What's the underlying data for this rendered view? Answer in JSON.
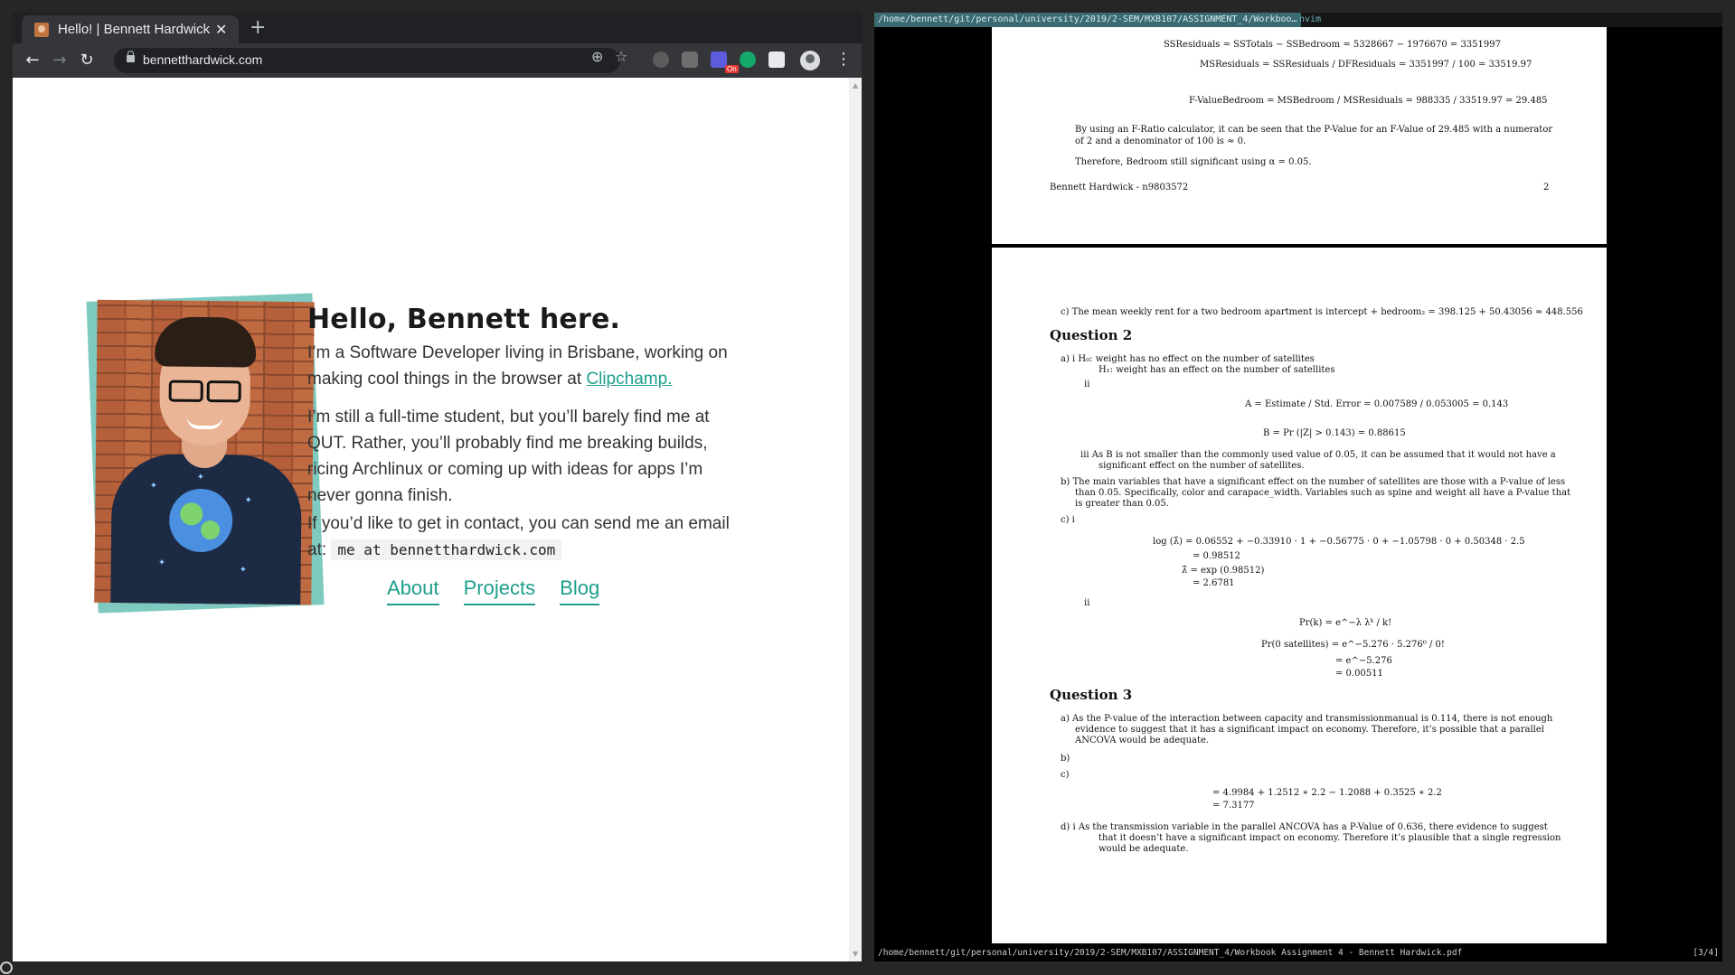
{
  "browser": {
    "tab_title": "Hello! | Bennett Hardwick",
    "tab_close": "✕",
    "new_tab": "+",
    "url": "bennetthardwick.com",
    "ext_badge": "On"
  },
  "page": {
    "heading": "Hello, Bennett here.",
    "p1_text": "I’m a Software Developer living in Brisbane, working on making cool things in the browser at ",
    "p1_link": "Clipchamp.",
    "p2_text": "I’m still a full-time student, but you’ll barely find me at QUT. Rather, you’ll probably find me breaking builds, ricing Archlinux or coming up with ideas for apps I’m never gonna finish.",
    "p3_text": "If you’d like to get in contact, you can send me an email at: ",
    "p3_email": "me at bennetthardwick.com",
    "nav": [
      "About",
      "Projects",
      "Blog"
    ],
    "accent_color": "#1e9f8c"
  },
  "viewer": {
    "title_path": "/home/bennett/git/personal/university/2019/2-SEM/MXB107/ASSIGNMENT_4/Workboo…",
    "app_name": "nvim",
    "status_path": "/home/bennett/git/personal/university/2019/2-SEM/MXB107/ASSIGNMENT_4/Workbook Assignment 4 - Bennett Hardwick.pdf",
    "page_indicator": "[3/4]",
    "page1": {
      "eq1": "SSResiduals = SSTotals − SSBedroom = 5328667 − 1976670 = 3351997",
      "eq2": "MSResiduals = SSResiduals / DFResiduals = 3351997 / 100 = 33519.97",
      "eq3": "F-ValueBedroom = MSBedroom / MSResiduals = 988335 / 33519.97 = 29.485",
      "text1": "By using an F-Ratio calculator, it can be seen that the P-Value for an F-Value of 29.485 with a numerator",
      "text1b": "of 2 and a denominator of 100 is ≈ 0.",
      "text2": "Therefore, Bedroom still significant using α = 0.05.",
      "footer_name": "Bennett Hardwick - n9803572",
      "footer_page": "2"
    },
    "page2": {
      "c_line": "c)  The mean weekly rent for a two bedroom apartment is intercept + bedroom₂ = 398.125 + 50.43056 ≈ 448.556",
      "q2": "Question 2",
      "q2a_i1": "a)      i  H₀: weight has no effect on the number of satellites",
      "q2a_i2": "H₁: weight has an effect on the number of satellites",
      "q2a_ii": "ii",
      "q2a_A": "A = Estimate / Std. Error = 0.007589 / 0.053005 = 0.143",
      "q2a_B": "B = Pr (|Z| > 0.143) = 0.88615",
      "q2a_iii1": "iii  As B is not smaller than the commonly used value of 0.05, it can be assumed that it would not have a",
      "q2a_iii2": "significant effect on the number of satellites.",
      "q2b1": "b)  The main variables that have a significant effect on the number of satellites are those with a P-value of less",
      "q2b2": "than 0.05. Specifically, color and carapace_width. Variables such as spine and weight all have a P-value that",
      "q2b3": "is greater than 0.05.",
      "q2c_i": "c)      i",
      "q2c_e1": "log (λ̂) = 0.06552 + −0.33910 · 1 + −0.56775 · 0 + −1.05798 · 0 + 0.50348 · 2.5",
      "q2c_e2": "= 0.98512",
      "q2c_e3": "λ̂ = exp (0.98512)",
      "q2c_e4": "= 2.6781",
      "q2c_ii": "ii",
      "q2c_p1": "Pr(k) = e^−λ λᵏ / k!",
      "q2c_p2": "Pr(0 satellites) = e^−5.276 · 5.276⁰ / 0!",
      "q2c_p3": "= e^−5.276",
      "q2c_p4": "= 0.00511",
      "q3": "Question 3",
      "q3a1": "a)  As the P-value of the interaction between capacity and transmissionmanual is 0.114, there is not enough",
      "q3a2": "evidence to suggest that it has a significant impact on economy. Therefore, it’s possible that a parallel",
      "q3a3": "ANCOVA would be adequate.",
      "q3b": "b)",
      "q3c": "c)",
      "q3c_e1": "= 4.9984 + 1.2512 ∗ 2.2 − 1.2088 + 0.3525 ∗ 2.2",
      "q3c_e2": "= 7.3177",
      "q3d1": "d)      i  As the transmission variable in the parallel ANCOVA has a P-Value of 0.636, there evidence to suggest",
      "q3d2": "that it doesn’t have a significant impact on economy. Therefore it’s plausible that a single regression",
      "q3d3": "would be adequate."
    }
  }
}
